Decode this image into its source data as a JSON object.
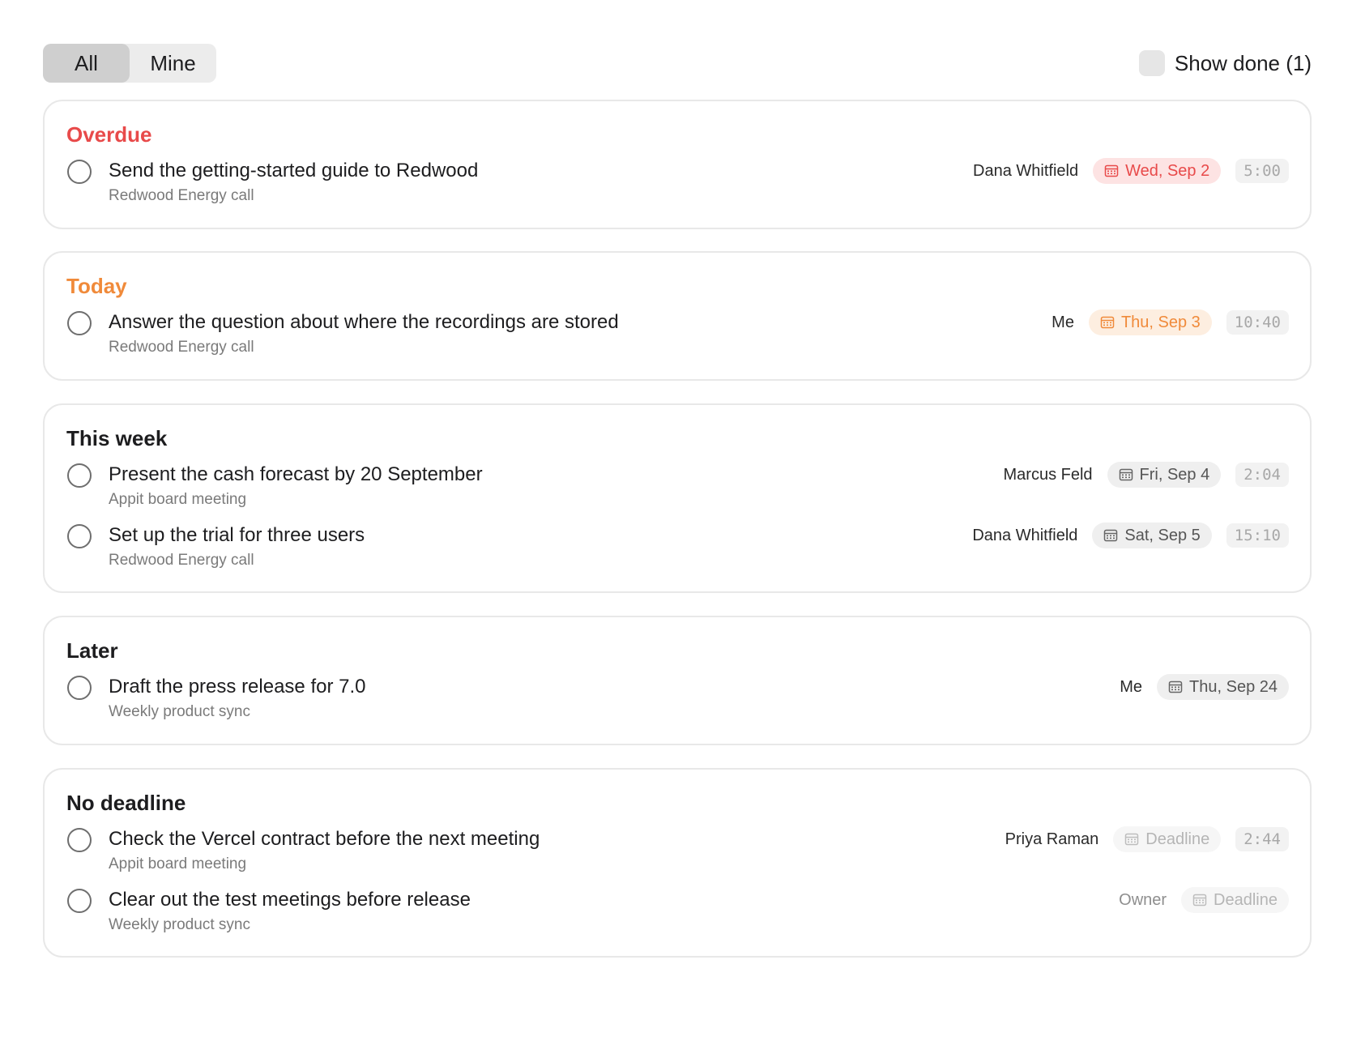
{
  "filter": {
    "tabs": [
      "All",
      "Mine"
    ],
    "active": "All"
  },
  "show_done": {
    "label": "Show done (1)",
    "checked": false
  },
  "sections": [
    {
      "title": "Overdue",
      "title_color": "#e84a4a",
      "tasks": [
        {
          "title": "Send the getting-started guide to Redwood",
          "source": "Redwood Energy call",
          "owner": "Dana Whitfield",
          "date": "Wed, Sep 2",
          "date_style": "red",
          "duration": "5:00"
        }
      ]
    },
    {
      "title": "Today",
      "title_color": "#f08a3a",
      "tasks": [
        {
          "title": "Answer the question about where the recordings are stored",
          "source": "Redwood Energy call",
          "owner": "Me",
          "date": "Thu, Sep 3",
          "date_style": "orange",
          "duration": "10:40"
        }
      ]
    },
    {
      "title": "This week",
      "title_color": "#1d1d1f",
      "tasks": [
        {
          "title": "Present the cash forecast by 20 September",
          "source": "Appit board meeting",
          "owner": "Marcus Feld",
          "date": "Fri, Sep 4",
          "date_style": "gray",
          "duration": "2:04"
        },
        {
          "title": "Set up the trial for three users",
          "source": "Redwood Energy call",
          "owner": "Dana Whitfield",
          "date": "Sat, Sep 5",
          "date_style": "gray",
          "duration": "15:10"
        }
      ]
    },
    {
      "title": "Later",
      "title_color": "#1d1d1f",
      "tasks": [
        {
          "title": "Draft the press release for 7.0",
          "source": "Weekly product sync",
          "owner": "Me",
          "date": "Thu, Sep 24",
          "date_style": "gray",
          "duration": ""
        }
      ]
    },
    {
      "title": "No deadline",
      "title_color": "#1d1d1f",
      "tasks": [
        {
          "title": "Check the Vercel contract before the next meeting",
          "source": "Appit board meeting",
          "owner": "Priya Raman",
          "date": "Deadline",
          "date_style": "empty",
          "duration": "2:44"
        },
        {
          "title": "Clear out the test meetings before release",
          "source": "Weekly product sync",
          "owner": "Owner",
          "owner_placeholder": true,
          "date": "Deadline",
          "date_style": "empty",
          "duration": ""
        }
      ]
    }
  ],
  "icons": {
    "date": "calendar-icon",
    "task_toggle": "circle-checkbox-icon"
  }
}
